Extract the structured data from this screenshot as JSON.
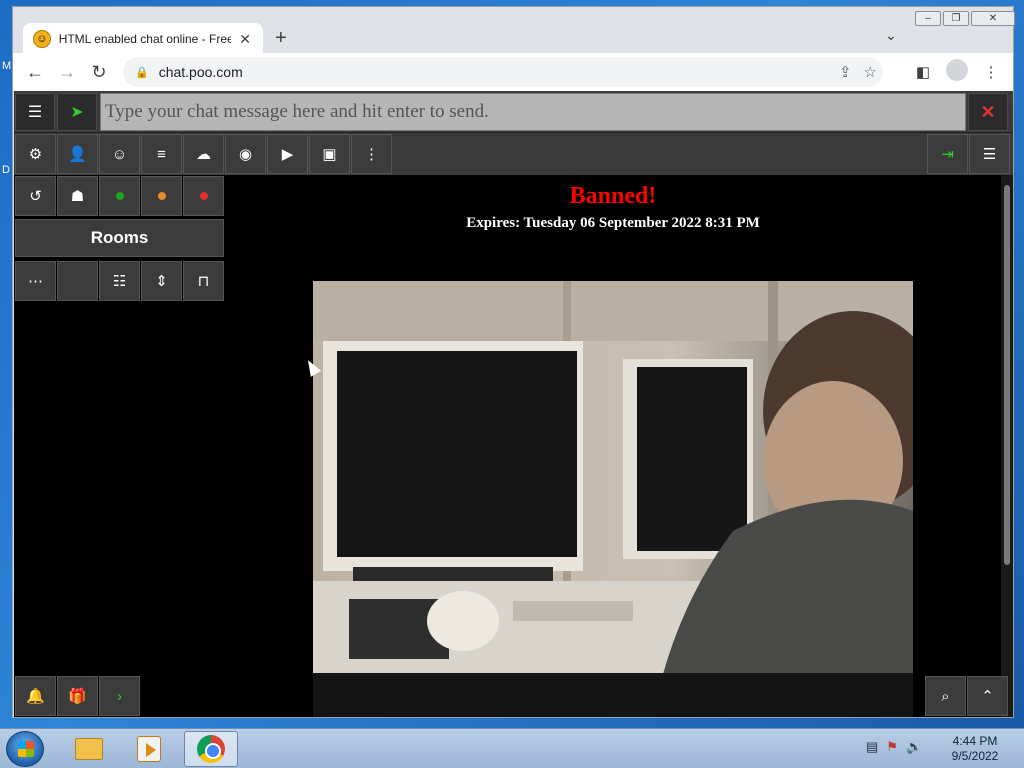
{
  "desktop": {
    "letter_m": "M",
    "letter_d": "D"
  },
  "browser": {
    "tab_title": "HTML enabled chat online - Free",
    "new_tab_symbol": "+",
    "tab_close_symbol": "✕",
    "tablist_symbol": "⌄",
    "url": "chat.poo.com",
    "window_controls": {
      "minimize": "–",
      "restore": "❐",
      "close": "✕"
    }
  },
  "chat": {
    "message_placeholder": "Type your chat message here and hit enter to send.",
    "rooms_label": "Rooms",
    "banned_title": "Banned!",
    "expires_text": "Expires: Tuesday 06 September 2022 8:31 PM",
    "status_dots": {
      "online": "#1fa31f",
      "away": "#e8892a",
      "busy": "#e52e2e"
    }
  },
  "colors": {
    "accent_green": "#2ecc2e",
    "banned_red": "#ff0000"
  },
  "taskbar": {
    "time": "4:44 PM",
    "date": "9/5/2022"
  }
}
